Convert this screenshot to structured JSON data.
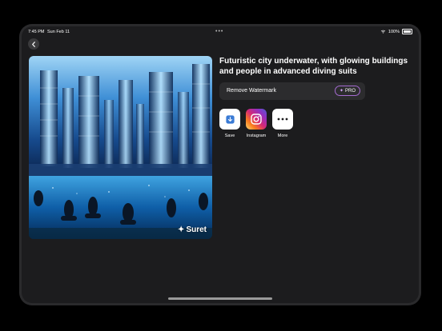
{
  "status_bar": {
    "time": "7:45 PM",
    "date": "Sun Feb 11",
    "battery": "100%"
  },
  "image": {
    "watermark": "Suret"
  },
  "prompt_text": "Futuristic city underwater, with glowing buildings and people in advanced diving suits",
  "remove_watermark": {
    "label": "Remove Watermark",
    "badge": "PRO"
  },
  "share": [
    {
      "label": "Save",
      "icon": "save-icon"
    },
    {
      "label": "Instagram",
      "icon": "instagram-icon"
    },
    {
      "label": "More",
      "icon": "more-icon"
    }
  ],
  "colors": {
    "background": "#1c1c1e",
    "row": "#2c2c2e",
    "pro_border": "#a56bd1"
  }
}
